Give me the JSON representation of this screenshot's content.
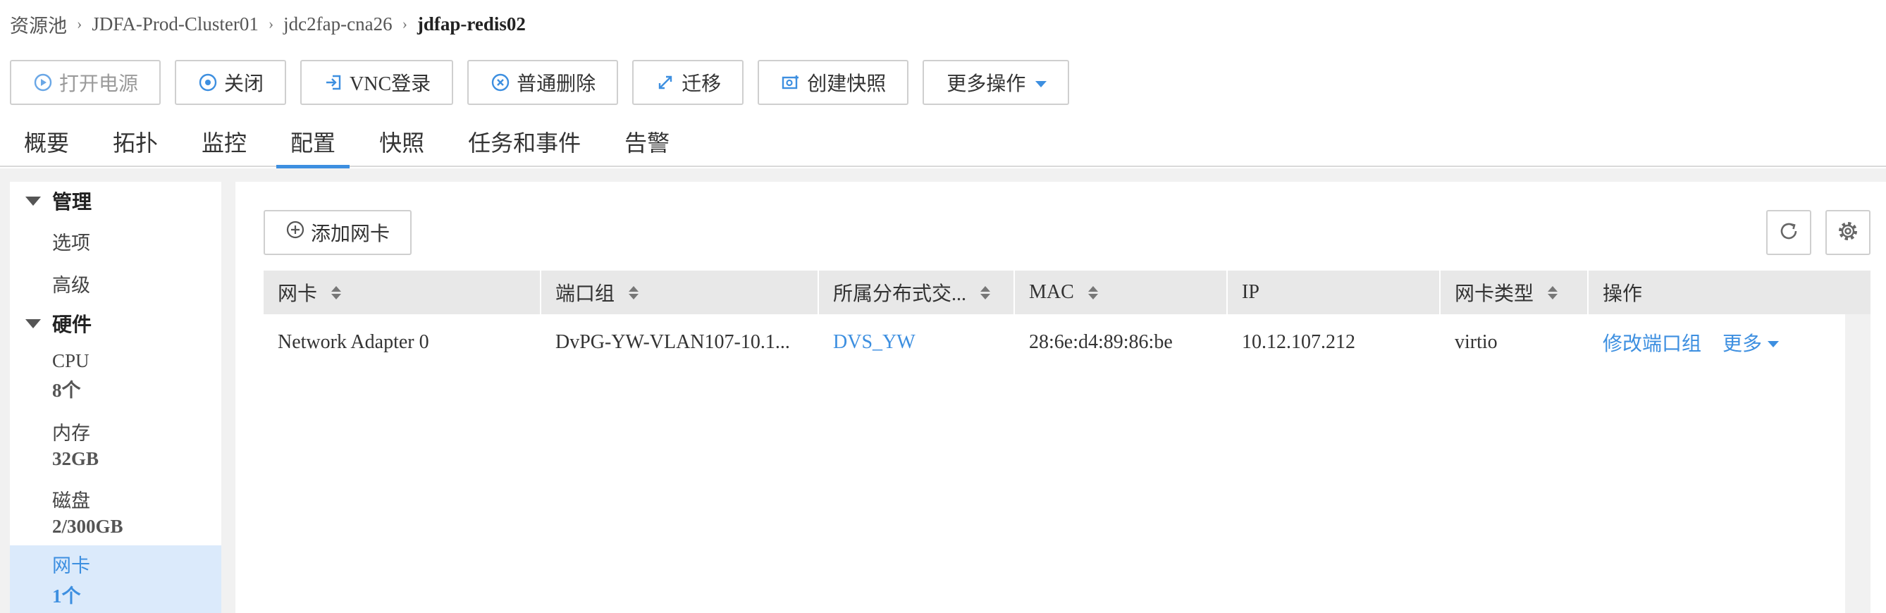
{
  "breadcrumb": [
    "资源池",
    "JDFA-Prod-Cluster01",
    "jdc2fap-cna26",
    "jdfap-redis02"
  ],
  "toolbar": {
    "power_on": "打开电源",
    "shutdown": "关闭",
    "vnc": "VNC登录",
    "delete": "普通删除",
    "migrate": "迁移",
    "snapshot": "创建快照",
    "more": "更多操作"
  },
  "tabs": [
    "概要",
    "拓扑",
    "监控",
    "配置",
    "快照",
    "任务和事件",
    "告警"
  ],
  "active_tab": "配置",
  "sidebar": {
    "manage_label": "管理",
    "options": "选项",
    "advanced": "高级",
    "hardware_label": "硬件",
    "cpu": {
      "label": "CPU",
      "value": "8个"
    },
    "memory": {
      "label": "内存",
      "value": "32GB"
    },
    "disk": {
      "label": "磁盘",
      "value": "2/300GB"
    },
    "nic": {
      "label": "网卡",
      "value": "1个"
    }
  },
  "main": {
    "add_nic": "添加网卡",
    "columns": [
      "网卡",
      "端口组",
      "所属分布式交...",
      "MAC",
      "IP",
      "网卡类型",
      "操作"
    ],
    "rows": [
      {
        "nic": "Network Adapter 0",
        "port_group": "DvPG-YW-VLAN107-10.1...",
        "dvs": "DVS_YW",
        "mac": "28:6e:d4:89:86:be",
        "ip": "10.12.107.212",
        "type": "virtio",
        "op_modify": "修改端口组",
        "op_more": "更多"
      }
    ]
  },
  "colors": {
    "accent": "#3d8fe0",
    "selected_bg": "#dbeafb",
    "header_bg": "#e8e8e8"
  }
}
